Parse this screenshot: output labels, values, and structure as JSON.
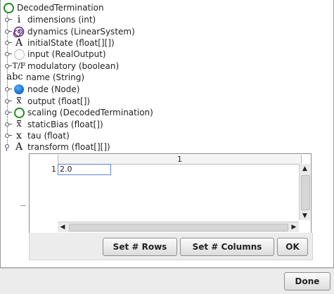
{
  "tree": {
    "root_label": "DecodedTermination",
    "items": [
      {
        "icon": "integer-i-icon",
        "label": "dimensions (int)"
      },
      {
        "icon": "linear-system-spiral-icon",
        "label": "dynamics (LinearSystem)"
      },
      {
        "icon": "matrix-a-icon",
        "label": "initialState (float[][])"
      },
      {
        "icon": "empty-circle-icon",
        "label": "input (RealOutput)"
      },
      {
        "icon": "boolean-tf-icon",
        "label": "modulatory (boolean)"
      },
      {
        "icon": "string-abc-icon",
        "label": "name (String)"
      },
      {
        "icon": "blue-node-icon",
        "label": "node (Node)"
      },
      {
        "icon": "vector-xbar-icon",
        "label": "output (float[])"
      },
      {
        "icon": "green-ring-icon",
        "label": "scaling (DecodedTermination)"
      },
      {
        "icon": "vector-xbar-icon",
        "label": "staticBias (float[])"
      },
      {
        "icon": "scalar-x-icon",
        "label": "tau (float)"
      },
      {
        "icon": "matrix-a-icon",
        "label": "transform (float[][])"
      }
    ]
  },
  "icon_glyphs": {
    "integer": "i",
    "matrix": "A",
    "tf": "T/F",
    "abc": "abc",
    "xbar": "x",
    "x": "x"
  },
  "table_editor": {
    "column_header": "1",
    "row_header": "1",
    "cell_value": "2.0"
  },
  "buttons": {
    "set_rows": "Set # Rows",
    "set_columns": "Set # Columns",
    "ok": "OK",
    "done": "Done"
  },
  "colors": {
    "accent_green": "#1e8a1e",
    "node_blue": "#1a78d6",
    "spiral_purple": "#5a1e7a"
  }
}
